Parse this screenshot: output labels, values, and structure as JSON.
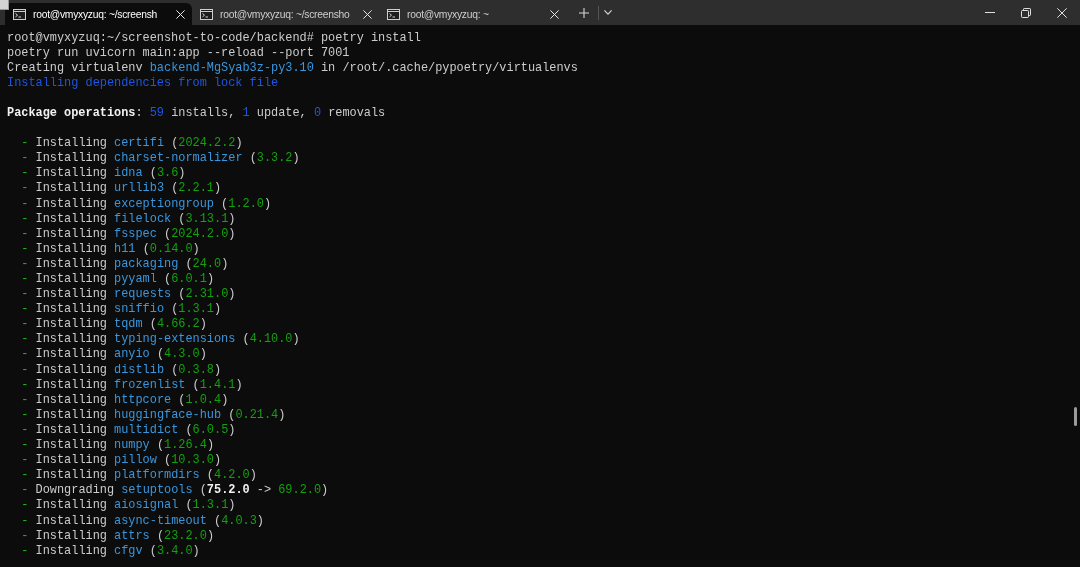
{
  "window": {
    "tabs": [
      {
        "title": "root@vmyxyzuq: ~/screensh",
        "selected": true
      },
      {
        "title": "root@vmyxyzuq: ~/screensho",
        "selected": false
      },
      {
        "title": "root@vmyxyzuq: ~",
        "selected": false
      }
    ]
  },
  "terminal": {
    "lines": [
      {
        "kind": "prompt",
        "segments": [
          {
            "kind": "text",
            "text": "root@vmyxyzuq:~/screenshot-to-code/backend# poetry install"
          }
        ]
      },
      {
        "kind": "output",
        "segments": [
          {
            "kind": "text",
            "text": "poetry run uvicorn main:app --reload --port 7001"
          }
        ]
      },
      {
        "kind": "output",
        "segments": [
          {
            "kind": "text",
            "text": "Creating virtualenv "
          },
          {
            "kind": "accent",
            "text": "backend-MgSyab3z-py3.10"
          },
          {
            "kind": "text",
            "text": " in /root/.cache/pypoetry/virtualenvs"
          }
        ]
      },
      {
        "kind": "output",
        "segments": [
          {
            "kind": "info",
            "text": "Installing dependencies from lock file"
          }
        ]
      },
      {
        "kind": "blank"
      },
      {
        "kind": "output",
        "segments": [
          {
            "kind": "strong",
            "text": "Package operations"
          },
          {
            "kind": "text",
            "text": ": "
          },
          {
            "kind": "info",
            "text": "59"
          },
          {
            "kind": "text",
            "text": " installs, "
          },
          {
            "kind": "info",
            "text": "1"
          },
          {
            "kind": "text",
            "text": " update, "
          },
          {
            "kind": "info",
            "text": "0"
          },
          {
            "kind": "text",
            "text": " removals"
          }
        ]
      },
      {
        "kind": "blank"
      },
      {
        "kind": "item",
        "segments": [
          {
            "kind": "bullet",
            "text": "- "
          },
          {
            "kind": "text",
            "text": "Installing "
          },
          {
            "kind": "accent",
            "text": "certifi"
          },
          {
            "kind": "text",
            "text": " ("
          },
          {
            "kind": "version",
            "text": "2024.2.2"
          },
          {
            "kind": "text",
            "text": ")"
          }
        ]
      },
      {
        "kind": "item",
        "segments": [
          {
            "kind": "bullet",
            "text": "- "
          },
          {
            "kind": "text",
            "text": "Installing "
          },
          {
            "kind": "accent",
            "text": "charset-normalizer"
          },
          {
            "kind": "text",
            "text": " ("
          },
          {
            "kind": "version",
            "text": "3.3.2"
          },
          {
            "kind": "text",
            "text": ")"
          }
        ]
      },
      {
        "kind": "item",
        "segments": [
          {
            "kind": "bullet",
            "text": "- "
          },
          {
            "kind": "text",
            "text": "Installing "
          },
          {
            "kind": "accent",
            "text": "idna"
          },
          {
            "kind": "text",
            "text": " ("
          },
          {
            "kind": "version",
            "text": "3.6"
          },
          {
            "kind": "text",
            "text": ")"
          }
        ]
      },
      {
        "kind": "item",
        "segments": [
          {
            "kind": "bullet",
            "text": "- "
          },
          {
            "kind": "text",
            "text": "Installing "
          },
          {
            "kind": "accent",
            "text": "urllib3"
          },
          {
            "kind": "text",
            "text": " ("
          },
          {
            "kind": "version",
            "text": "2.2.1"
          },
          {
            "kind": "text",
            "text": ")"
          }
        ]
      },
      {
        "kind": "item",
        "segments": [
          {
            "kind": "bullet",
            "text": "- "
          },
          {
            "kind": "text",
            "text": "Installing "
          },
          {
            "kind": "accent",
            "text": "exceptiongroup"
          },
          {
            "kind": "text",
            "text": " ("
          },
          {
            "kind": "version",
            "text": "1.2.0"
          },
          {
            "kind": "text",
            "text": ")"
          }
        ]
      },
      {
        "kind": "item",
        "segments": [
          {
            "kind": "bullet",
            "text": "- "
          },
          {
            "kind": "text",
            "text": "Installing "
          },
          {
            "kind": "accent",
            "text": "filelock"
          },
          {
            "kind": "text",
            "text": " ("
          },
          {
            "kind": "version",
            "text": "3.13.1"
          },
          {
            "kind": "text",
            "text": ")"
          }
        ]
      },
      {
        "kind": "item",
        "segments": [
          {
            "kind": "bullet",
            "text": "- "
          },
          {
            "kind": "text",
            "text": "Installing "
          },
          {
            "kind": "accent",
            "text": "fsspec"
          },
          {
            "kind": "text",
            "text": " ("
          },
          {
            "kind": "version",
            "text": "2024.2.0"
          },
          {
            "kind": "text",
            "text": ")"
          }
        ]
      },
      {
        "kind": "item",
        "segments": [
          {
            "kind": "bullet",
            "text": "- "
          },
          {
            "kind": "text",
            "text": "Installing "
          },
          {
            "kind": "accent",
            "text": "h11"
          },
          {
            "kind": "text",
            "text": " ("
          },
          {
            "kind": "version",
            "text": "0.14.0"
          },
          {
            "kind": "text",
            "text": ")"
          }
        ]
      },
      {
        "kind": "item",
        "segments": [
          {
            "kind": "bullet",
            "text": "- "
          },
          {
            "kind": "text",
            "text": "Installing "
          },
          {
            "kind": "accent",
            "text": "packaging"
          },
          {
            "kind": "text",
            "text": " ("
          },
          {
            "kind": "version",
            "text": "24.0"
          },
          {
            "kind": "text",
            "text": ")"
          }
        ]
      },
      {
        "kind": "item",
        "segments": [
          {
            "kind": "bullet",
            "text": "- "
          },
          {
            "kind": "text",
            "text": "Installing "
          },
          {
            "kind": "accent",
            "text": "pyyaml"
          },
          {
            "kind": "text",
            "text": " ("
          },
          {
            "kind": "version",
            "text": "6.0.1"
          },
          {
            "kind": "text",
            "text": ")"
          }
        ]
      },
      {
        "kind": "item",
        "segments": [
          {
            "kind": "bullet",
            "text": "- "
          },
          {
            "kind": "text",
            "text": "Installing "
          },
          {
            "kind": "accent",
            "text": "requests"
          },
          {
            "kind": "text",
            "text": " ("
          },
          {
            "kind": "version",
            "text": "2.31.0"
          },
          {
            "kind": "text",
            "text": ")"
          }
        ]
      },
      {
        "kind": "item",
        "segments": [
          {
            "kind": "bullet",
            "text": "- "
          },
          {
            "kind": "text",
            "text": "Installing "
          },
          {
            "kind": "accent",
            "text": "sniffio"
          },
          {
            "kind": "text",
            "text": " ("
          },
          {
            "kind": "version",
            "text": "1.3.1"
          },
          {
            "kind": "text",
            "text": ")"
          }
        ]
      },
      {
        "kind": "item",
        "segments": [
          {
            "kind": "bullet",
            "text": "- "
          },
          {
            "kind": "text",
            "text": "Installing "
          },
          {
            "kind": "accent",
            "text": "tqdm"
          },
          {
            "kind": "text",
            "text": " ("
          },
          {
            "kind": "version",
            "text": "4.66.2"
          },
          {
            "kind": "text",
            "text": ")"
          }
        ]
      },
      {
        "kind": "item",
        "segments": [
          {
            "kind": "bullet",
            "text": "- "
          },
          {
            "kind": "text",
            "text": "Installing "
          },
          {
            "kind": "accent",
            "text": "typing-extensions"
          },
          {
            "kind": "text",
            "text": " ("
          },
          {
            "kind": "version",
            "text": "4.10.0"
          },
          {
            "kind": "text",
            "text": ")"
          }
        ]
      },
      {
        "kind": "item",
        "segments": [
          {
            "kind": "bullet",
            "text": "- "
          },
          {
            "kind": "text",
            "text": "Installing "
          },
          {
            "kind": "accent",
            "text": "anyio"
          },
          {
            "kind": "text",
            "text": " ("
          },
          {
            "kind": "version",
            "text": "4.3.0"
          },
          {
            "kind": "text",
            "text": ")"
          }
        ]
      },
      {
        "kind": "item",
        "segments": [
          {
            "kind": "bullet",
            "text": "- "
          },
          {
            "kind": "text",
            "text": "Installing "
          },
          {
            "kind": "accent",
            "text": "distlib"
          },
          {
            "kind": "text",
            "text": " ("
          },
          {
            "kind": "version",
            "text": "0.3.8"
          },
          {
            "kind": "text",
            "text": ")"
          }
        ]
      },
      {
        "kind": "item",
        "segments": [
          {
            "kind": "bullet",
            "text": "- "
          },
          {
            "kind": "text",
            "text": "Installing "
          },
          {
            "kind": "accent",
            "text": "frozenlist"
          },
          {
            "kind": "text",
            "text": " ("
          },
          {
            "kind": "version",
            "text": "1.4.1"
          },
          {
            "kind": "text",
            "text": ")"
          }
        ]
      },
      {
        "kind": "item",
        "segments": [
          {
            "kind": "bullet",
            "text": "- "
          },
          {
            "kind": "text",
            "text": "Installing "
          },
          {
            "kind": "accent",
            "text": "httpcore"
          },
          {
            "kind": "text",
            "text": " ("
          },
          {
            "kind": "version",
            "text": "1.0.4"
          },
          {
            "kind": "text",
            "text": ")"
          }
        ]
      },
      {
        "kind": "item",
        "segments": [
          {
            "kind": "bullet",
            "text": "- "
          },
          {
            "kind": "text",
            "text": "Installing "
          },
          {
            "kind": "accent",
            "text": "huggingface-hub"
          },
          {
            "kind": "text",
            "text": " ("
          },
          {
            "kind": "version",
            "text": "0.21.4"
          },
          {
            "kind": "text",
            "text": ")"
          }
        ]
      },
      {
        "kind": "item",
        "segments": [
          {
            "kind": "bullet",
            "text": "- "
          },
          {
            "kind": "text",
            "text": "Installing "
          },
          {
            "kind": "accent",
            "text": "multidict"
          },
          {
            "kind": "text",
            "text": " ("
          },
          {
            "kind": "version",
            "text": "6.0.5"
          },
          {
            "kind": "text",
            "text": ")"
          }
        ]
      },
      {
        "kind": "item",
        "segments": [
          {
            "kind": "bullet",
            "text": "- "
          },
          {
            "kind": "text",
            "text": "Installing "
          },
          {
            "kind": "accent",
            "text": "numpy"
          },
          {
            "kind": "text",
            "text": " ("
          },
          {
            "kind": "version",
            "text": "1.26.4"
          },
          {
            "kind": "text",
            "text": ")"
          }
        ]
      },
      {
        "kind": "item",
        "segments": [
          {
            "kind": "bullet",
            "text": "- "
          },
          {
            "kind": "text",
            "text": "Installing "
          },
          {
            "kind": "accent",
            "text": "pillow"
          },
          {
            "kind": "text",
            "text": " ("
          },
          {
            "kind": "version",
            "text": "10.3.0"
          },
          {
            "kind": "text",
            "text": ")"
          }
        ]
      },
      {
        "kind": "item",
        "segments": [
          {
            "kind": "bullet",
            "text": "- "
          },
          {
            "kind": "text",
            "text": "Installing "
          },
          {
            "kind": "accent",
            "text": "platformdirs"
          },
          {
            "kind": "text",
            "text": " ("
          },
          {
            "kind": "version",
            "text": "4.2.0"
          },
          {
            "kind": "text",
            "text": ")"
          }
        ]
      },
      {
        "kind": "item",
        "segments": [
          {
            "kind": "bullet",
            "text": "- "
          },
          {
            "kind": "text",
            "text": "Downgrading "
          },
          {
            "kind": "accent",
            "text": "setuptools"
          },
          {
            "kind": "text",
            "text": " ("
          },
          {
            "kind": "strong",
            "text": "75.2.0"
          },
          {
            "kind": "text",
            "text": " -> "
          },
          {
            "kind": "version",
            "text": "69.2.0"
          },
          {
            "kind": "text",
            "text": ")"
          }
        ]
      },
      {
        "kind": "item",
        "segments": [
          {
            "kind": "bullet",
            "text": "- "
          },
          {
            "kind": "text",
            "text": "Installing "
          },
          {
            "kind": "accent",
            "text": "aiosignal"
          },
          {
            "kind": "text",
            "text": " ("
          },
          {
            "kind": "version",
            "text": "1.3.1"
          },
          {
            "kind": "text",
            "text": ")"
          }
        ]
      },
      {
        "kind": "item",
        "segments": [
          {
            "kind": "bullet",
            "text": "- "
          },
          {
            "kind": "text",
            "text": "Installing "
          },
          {
            "kind": "accent",
            "text": "async-timeout"
          },
          {
            "kind": "text",
            "text": " ("
          },
          {
            "kind": "version",
            "text": "4.0.3"
          },
          {
            "kind": "text",
            "text": ")"
          }
        ]
      },
      {
        "kind": "item",
        "segments": [
          {
            "kind": "bullet",
            "text": "- "
          },
          {
            "kind": "text",
            "text": "Installing "
          },
          {
            "kind": "accent",
            "text": "attrs"
          },
          {
            "kind": "text",
            "text": " ("
          },
          {
            "kind": "version",
            "text": "23.2.0"
          },
          {
            "kind": "text",
            "text": ")"
          }
        ]
      },
      {
        "kind": "item",
        "segments": [
          {
            "kind": "bullet",
            "text": "- "
          },
          {
            "kind": "text",
            "text": "Installing "
          },
          {
            "kind": "accent",
            "text": "cfgv"
          },
          {
            "kind": "text",
            "text": " ("
          },
          {
            "kind": "version",
            "text": "3.4.0"
          },
          {
            "kind": "text",
            "text": ")"
          }
        ]
      }
    ]
  }
}
